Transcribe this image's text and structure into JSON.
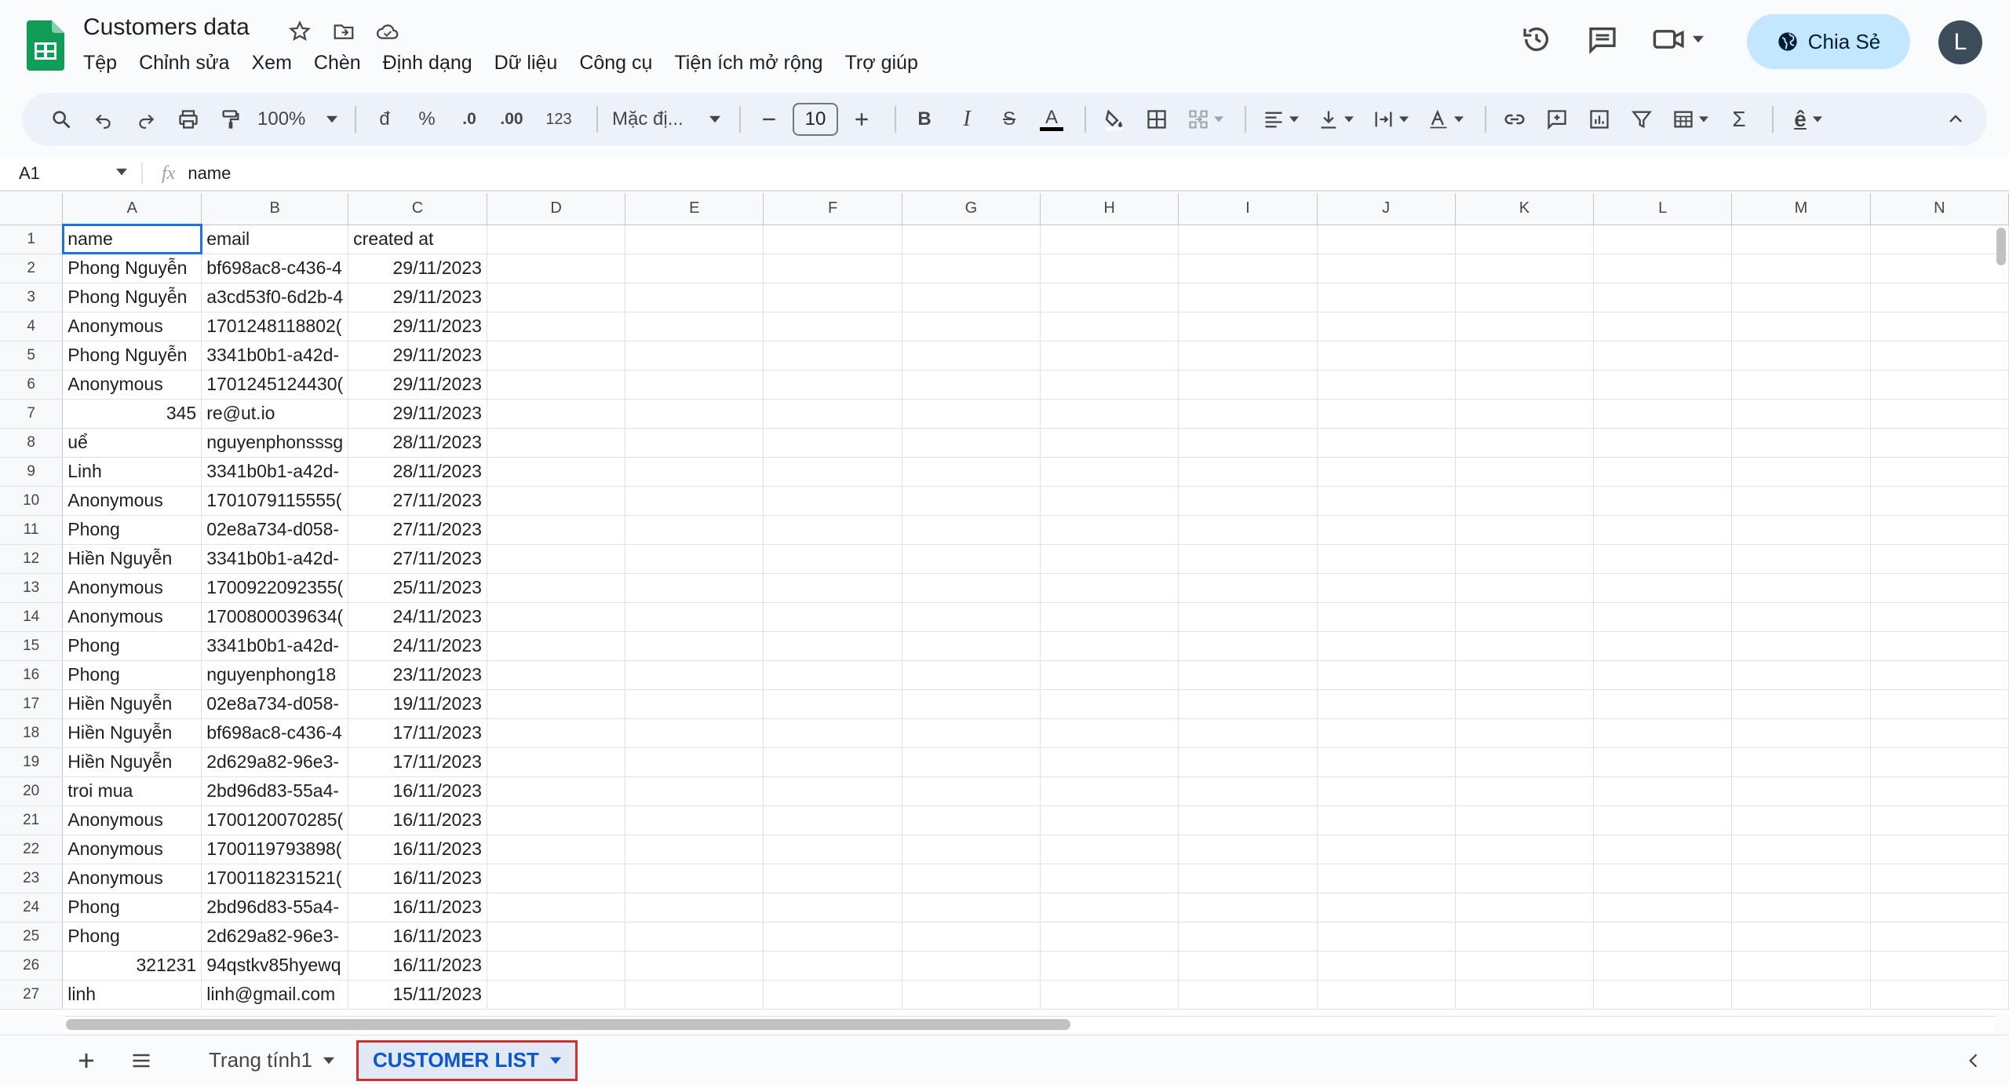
{
  "app": {
    "title": "Customers data",
    "menu": [
      "Tệp",
      "Chỉnh sửa",
      "Xem",
      "Chèn",
      "Định dạng",
      "Dữ liệu",
      "Công cụ",
      "Tiện ích mở rộng",
      "Trợ giúp"
    ],
    "share_label": "Chia Sẻ",
    "avatar_letter": "L"
  },
  "toolbar": {
    "zoom": "100%",
    "currency": "đ",
    "percent": "%",
    "decrease_decimal": ".0",
    "increase_decimal": ".00",
    "number_format": "123",
    "font": "Mặc đị...",
    "font_size": "10",
    "bold": "B",
    "italic": "I",
    "strike": "S",
    "text_color": "A",
    "sum": "Σ",
    "input_tool": "ê"
  },
  "formula_bar": {
    "cell_ref": "A1",
    "fx": "fx",
    "value": "name"
  },
  "grid": {
    "columns": [
      "A",
      "B",
      "C",
      "D",
      "E",
      "F",
      "G",
      "H",
      "I",
      "J",
      "K",
      "L",
      "M",
      "N"
    ],
    "rows": [
      {
        "n": "1",
        "a": "name",
        "b": "email",
        "c": "created at",
        "a_num": false
      },
      {
        "n": "2",
        "a": "Phong Nguyễn",
        "b": "bf698ac8-c436-4",
        "c": "29/11/2023",
        "a_num": false
      },
      {
        "n": "3",
        "a": "Phong Nguyễn",
        "b": "a3cd53f0-6d2b-4",
        "c": "29/11/2023",
        "a_num": false
      },
      {
        "n": "4",
        "a": "Anonymous",
        "b": "1701248118802(",
        "c": "29/11/2023",
        "a_num": false
      },
      {
        "n": "5",
        "a": "Phong Nguyễn",
        "b": "3341b0b1-a42d-",
        "c": "29/11/2023",
        "a_num": false
      },
      {
        "n": "6",
        "a": "Anonymous",
        "b": "1701245124430(",
        "c": "29/11/2023",
        "a_num": false
      },
      {
        "n": "7",
        "a": "345",
        "b": "re@ut.io",
        "c": "29/11/2023",
        "a_num": true
      },
      {
        "n": "8",
        "a": "uể",
        "b": "nguyenphonsssg",
        "c": "28/11/2023",
        "a_num": false
      },
      {
        "n": "9",
        "a": "Linh",
        "b": "3341b0b1-a42d-",
        "c": "28/11/2023",
        "a_num": false
      },
      {
        "n": "10",
        "a": "Anonymous",
        "b": "1701079115555(",
        "c": "27/11/2023",
        "a_num": false
      },
      {
        "n": "11",
        "a": "Phong",
        "b": "02e8a734-d058-",
        "c": "27/11/2023",
        "a_num": false
      },
      {
        "n": "12",
        "a": "Hiền Nguyễn",
        "b": "3341b0b1-a42d-",
        "c": "27/11/2023",
        "a_num": false
      },
      {
        "n": "13",
        "a": "Anonymous",
        "b": "1700922092355(",
        "c": "25/11/2023",
        "a_num": false
      },
      {
        "n": "14",
        "a": "Anonymous",
        "b": "1700800039634(",
        "c": "24/11/2023",
        "a_num": false
      },
      {
        "n": "15",
        "a": "Phong",
        "b": "3341b0b1-a42d-",
        "c": "24/11/2023",
        "a_num": false
      },
      {
        "n": "16",
        "a": "Phong",
        "b": "nguyenphong18",
        "c": "23/11/2023",
        "a_num": false
      },
      {
        "n": "17",
        "a": "Hiền Nguyễn",
        "b": "02e8a734-d058-",
        "c": "19/11/2023",
        "a_num": false
      },
      {
        "n": "18",
        "a": "Hiền Nguyễn",
        "b": "bf698ac8-c436-4",
        "c": "17/11/2023",
        "a_num": false
      },
      {
        "n": "19",
        "a": "Hiền Nguyễn",
        "b": "2d629a82-96e3-",
        "c": "17/11/2023",
        "a_num": false
      },
      {
        "n": "20",
        "a": "troi mua",
        "b": "2bd96d83-55a4-",
        "c": "16/11/2023",
        "a_num": false
      },
      {
        "n": "21",
        "a": "Anonymous",
        "b": "1700120070285(",
        "c": "16/11/2023",
        "a_num": false
      },
      {
        "n": "22",
        "a": "Anonymous",
        "b": "1700119793898(",
        "c": "16/11/2023",
        "a_num": false
      },
      {
        "n": "23",
        "a": "Anonymous",
        "b": "1700118231521(",
        "c": "16/11/2023",
        "a_num": false
      },
      {
        "n": "24",
        "a": "Phong",
        "b": "2bd96d83-55a4-",
        "c": "16/11/2023",
        "a_num": false
      },
      {
        "n": "25",
        "a": "Phong",
        "b": "2d629a82-96e3-",
        "c": "16/11/2023",
        "a_num": false
      },
      {
        "n": "26",
        "a": "321231",
        "b": "94qstkv85hyewq",
        "c": "16/11/2023",
        "a_num": true
      },
      {
        "n": "27",
        "a": "linh",
        "b": "linh@gmail.com",
        "c": "15/11/2023",
        "a_num": false
      }
    ]
  },
  "sheets": {
    "tabs": [
      {
        "label": "Trang tính1",
        "active": false
      },
      {
        "label": "CUSTOMER LIST",
        "active": true
      }
    ]
  },
  "colors": {
    "accent": "#0b57d0",
    "share_bg": "#c2e7ff",
    "highlight_border": "#d32f2f",
    "sheets_green": "#0f9d58"
  }
}
